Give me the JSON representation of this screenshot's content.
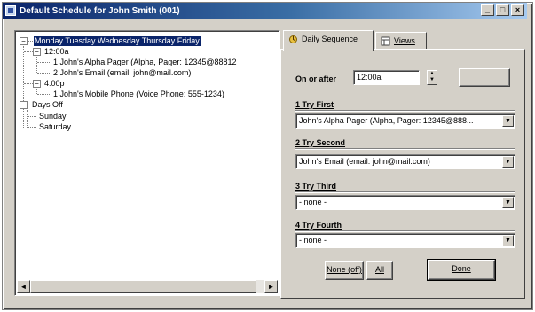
{
  "window": {
    "title": "Default Schedule for John Smith (001)",
    "minimize": "_",
    "maximize": "□",
    "close": "×"
  },
  "tree": {
    "root": "Monday Tuesday Wednesday Thursday Friday",
    "time1": "12:00a",
    "time1_items": [
      "1 John's Alpha Pager (Alpha, Pager: 12345@88812",
      "2 John's Email (email: john@mail.com)"
    ],
    "time2": "4:00p",
    "time2_items": [
      "1 John's Mobile Phone (Voice Phone: 555-1234)"
    ],
    "daysoff": "Days Off",
    "daysoff_items": [
      "Sunday",
      "Saturday"
    ],
    "scroll_left": "◄",
    "scroll_right": "►"
  },
  "tabs": {
    "daily": "Daily Sequence",
    "views": "Views"
  },
  "panel": {
    "on_or_after_label": "On or after",
    "on_or_after_value": "12:00a",
    "try_first_label": "1 Try First",
    "try_first_value": "John's Alpha Pager (Alpha, Pager: 12345@888...",
    "try_second_label": "2 Try Second",
    "try_second_value": "John's Email (email: john@mail.com)",
    "try_third_label": "3 Try Third",
    "try_third_value": "- none -",
    "try_fourth_label": "4 Try Fourth",
    "try_fourth_value": "- none -",
    "none_off_button": "None (off)",
    "all_button": "All",
    "done_button": "Done",
    "arrow": "▼",
    "spin_up": "▲",
    "spin_down": "▼"
  }
}
